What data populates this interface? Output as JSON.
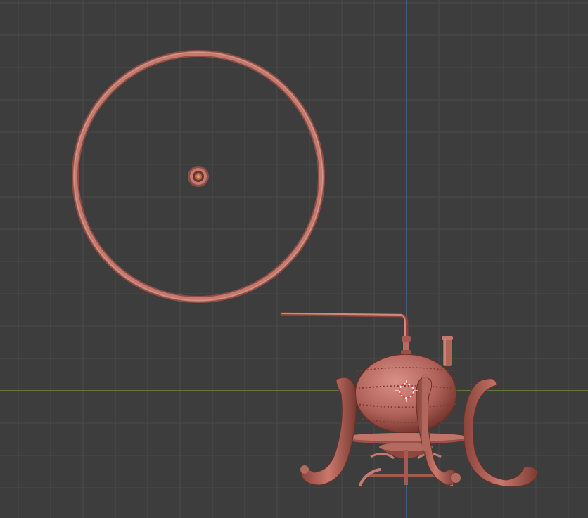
{
  "viewport": {
    "colors": {
      "background": "#3d3d3d",
      "grid_minor": "#444444",
      "grid_major": "#4a4a4a",
      "axis_x": "#7a9a3a",
      "axis_y": "#4b6fa8",
      "material": "#b56a5e",
      "material_light": "#d38f84",
      "material_dark": "#7a3a32",
      "origin_dot": "#f0a020",
      "cursor_red": "#e04040",
      "cursor_white": "#ffffff"
    },
    "objects": [
      {
        "name": "torus-ring",
        "icon": "circle-outline"
      },
      {
        "name": "still-apparatus",
        "icon": "steampunk-still"
      }
    ],
    "cursor": {
      "icon": "3d-cursor-icon"
    }
  }
}
